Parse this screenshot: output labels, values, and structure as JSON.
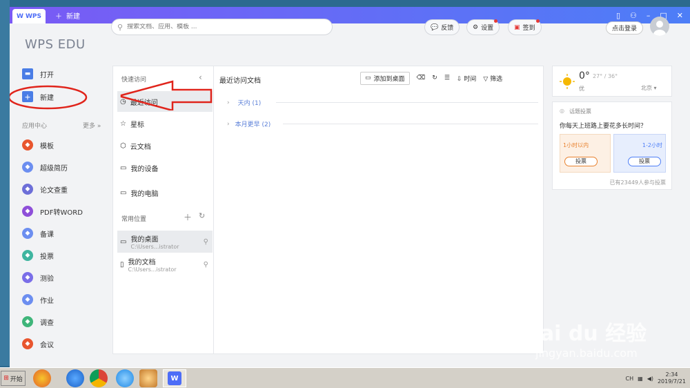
{
  "titlebar": {
    "tab_wps": "WPS",
    "tab_new": "新建"
  },
  "brand": "WPS EDU",
  "search": {
    "placeholder": "搜索文档、应用、模板 ..."
  },
  "toolbar": {
    "feedback": "反馈",
    "settings": "设置",
    "signin": "签到",
    "login": "点击登录"
  },
  "sidebar": {
    "open": "打开",
    "new": "新建",
    "app_center": "应用中心",
    "more": "更多",
    "apps": [
      {
        "label": "模板",
        "color": "#e8552e"
      },
      {
        "label": "超级简历",
        "color": "#6c8ef0"
      },
      {
        "label": "论文查重",
        "color": "#6d6fd8"
      },
      {
        "label": "PDF转WORD",
        "color": "#8e4fd9"
      },
      {
        "label": "备课",
        "color": "#6c8ef0"
      },
      {
        "label": "投票",
        "color": "#3fb5a0"
      },
      {
        "label": "测验",
        "color": "#7a6ee8"
      },
      {
        "label": "作业",
        "color": "#6c8ef0"
      },
      {
        "label": "调查",
        "color": "#3fb57a"
      },
      {
        "label": "会议",
        "color": "#e8552e"
      }
    ]
  },
  "quick": {
    "title": "快速访问",
    "items": [
      "最近访问",
      "星标",
      "云文档",
      "我的设备",
      "我的电脑"
    ],
    "common_title": "常用位置",
    "locations": [
      {
        "name": "我的桌面",
        "path": "C:\\Users...istrator"
      },
      {
        "name": "我的文档",
        "path": "C:\\Users...istrator"
      }
    ]
  },
  "files": {
    "title": "最近访问文档",
    "add_desktop": "添加到桌面",
    "sort_time": "时间",
    "filter": "筛选",
    "groups": [
      "天内 (1)",
      "本月更早 (2)"
    ]
  },
  "weather": {
    "temp": "0°",
    "range": "27° / 36°",
    "quality": "优",
    "city": "北京"
  },
  "vote": {
    "label": "话题投票",
    "question": "你每天上班路上要花多长时间？",
    "opt1": "1小时以内",
    "opt2": "1-2小时",
    "btn": "投票",
    "count": "已有23449人参与投票"
  },
  "taskbar": {
    "start": "开始",
    "lang": "CH",
    "time": "2:34",
    "date": "2019/7/21"
  },
  "watermark": {
    "logo": "Bai du 经验",
    "url": "jingyan.baidu.com"
  },
  "colors": {
    "accent": "#4d7ef7",
    "annotation": "#e0241b"
  }
}
